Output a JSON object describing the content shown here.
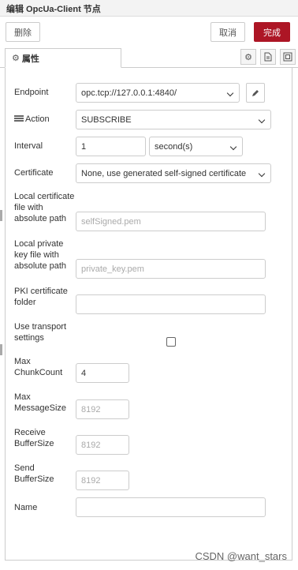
{
  "title": "编辑 OpcUa-Client 节点",
  "toolbar": {
    "delete_label": "删除",
    "cancel_label": "取消",
    "done_label": "完成"
  },
  "tab": {
    "label": "属性"
  },
  "form": {
    "endpoint_label": "Endpoint",
    "endpoint_value": "opc.tcp://127.0.0.1:4840/",
    "action_label": "Action",
    "action_value": "SUBSCRIBE",
    "interval_label": "Interval",
    "interval_value": "1",
    "interval_unit": "second(s)",
    "certificate_label": "Certificate",
    "certificate_value": "None, use generated self-signed certificate",
    "local_cert_label": [
      "Local certificate",
      "file with",
      "absolute path"
    ],
    "local_cert_placeholder": "selfSigned.pem",
    "private_key_label": [
      "Local private",
      "key file with",
      "absolute path"
    ],
    "private_key_placeholder": "private_key.pem",
    "pki_label": [
      "PKI certificate",
      "folder"
    ],
    "pki_value": "",
    "transport_label": [
      "Use transport",
      "settings"
    ],
    "max_chunk_label": [
      "Max",
      "ChunkCount"
    ],
    "max_chunk_value": "4",
    "max_message_label": [
      "Max",
      "MessageSize"
    ],
    "max_message_placeholder": "8192",
    "receive_buffer_label": [
      "Receive",
      "BufferSize"
    ],
    "receive_buffer_placeholder": "8192",
    "send_buffer_label": [
      "Send",
      "BufferSize"
    ],
    "send_buffer_placeholder": "8192",
    "name_label": "Name",
    "name_value": ""
  },
  "watermark": "CSDN @want_stars",
  "colors": {
    "primary": "#ad1625",
    "border": "#cccccc"
  }
}
